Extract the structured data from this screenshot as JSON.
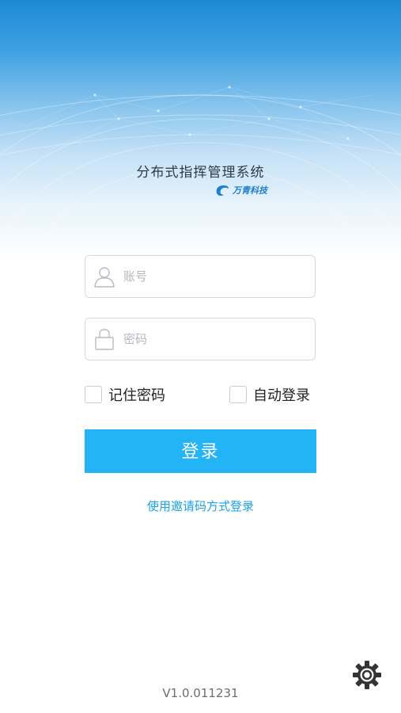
{
  "header": {
    "app_title": "分布式指挥管理系统",
    "brand_name": "万青科技"
  },
  "form": {
    "account_placeholder": "账号",
    "password_placeholder": "密码",
    "remember_password_label": "记住密码",
    "auto_login_label": "自动登录",
    "login_button_label": "登录",
    "invite_login_link": "使用邀请码方式登录"
  },
  "footer": {
    "version": "V1.0.011231"
  },
  "icons": {
    "account": "user-icon",
    "password": "lock-icon",
    "settings": "gear-icon",
    "brand": "brand-logo-icon"
  },
  "colors": {
    "accent": "#23b4f5",
    "link": "#1aa3e8",
    "hero_top": "#1d89d6"
  }
}
